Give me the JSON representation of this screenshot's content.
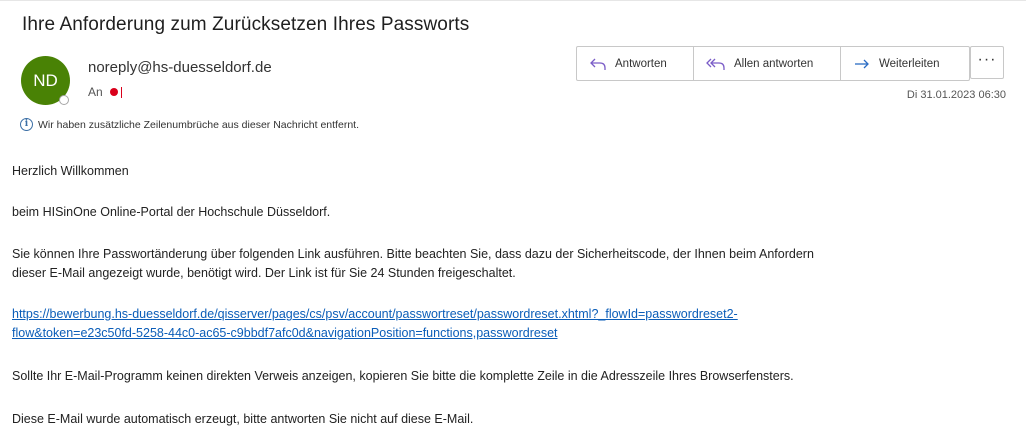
{
  "email": {
    "subject": "Ihre Anforderung zum Zurücksetzen Ihres Passworts",
    "avatar_initials": "ND",
    "sender": "noreply@hs-duesseldorf.de",
    "to_label": "An",
    "info_notice": "Wir haben zusätzliche Zeilenumbrüche aus dieser Nachricht entfernt.",
    "date": "Di 31.01.2023 06:30"
  },
  "actions": {
    "reply": "Antworten",
    "reply_all": "Allen antworten",
    "forward": "Weiterleiten",
    "more": "···"
  },
  "body": {
    "greeting": "Herzlich Willkommen",
    "line2": "beim HISinOne Online-Portal der Hochschule Düsseldorf.",
    "para3_line1": "Sie können Ihre Passwortänderung über folgenden Link ausführen. Bitte beachten Sie, dass dazu der Sicherheitscode, der Ihnen beim Anfordern",
    "para3_line2": "dieser E-Mail angezeigt wurde, benötigt wird. Der Link ist für Sie 24 Stunden freigeschaltet.",
    "link_line1": "https://bewerbung.hs-duesseldorf.de/qisserver/pages/cs/psv/account/passwortreset/passwordreset.xhtml?_flowId=passwordreset2-",
    "link_line2": "flow&token=e23c50fd-5258-44c0-ac65-c9bbdf7afc0d&navigationPosition=functions,passwordreset",
    "para5": "Sollte Ihr E-Mail-Programm keinen direkten Verweis anzeigen, kopieren Sie bitte die komplette Zeile in die Adresszeile Ihres Browserfensters.",
    "para6": "Diese E-Mail wurde automatisch erzeugt, bitte antworten Sie nicht auf diese E-Mail."
  },
  "colors": {
    "avatar_bg": "#498205",
    "link": "#0b5db8",
    "icon_accent": "#7a5cc7",
    "forward_accent": "#2b6cc4",
    "presence_red": "#d9001b"
  }
}
